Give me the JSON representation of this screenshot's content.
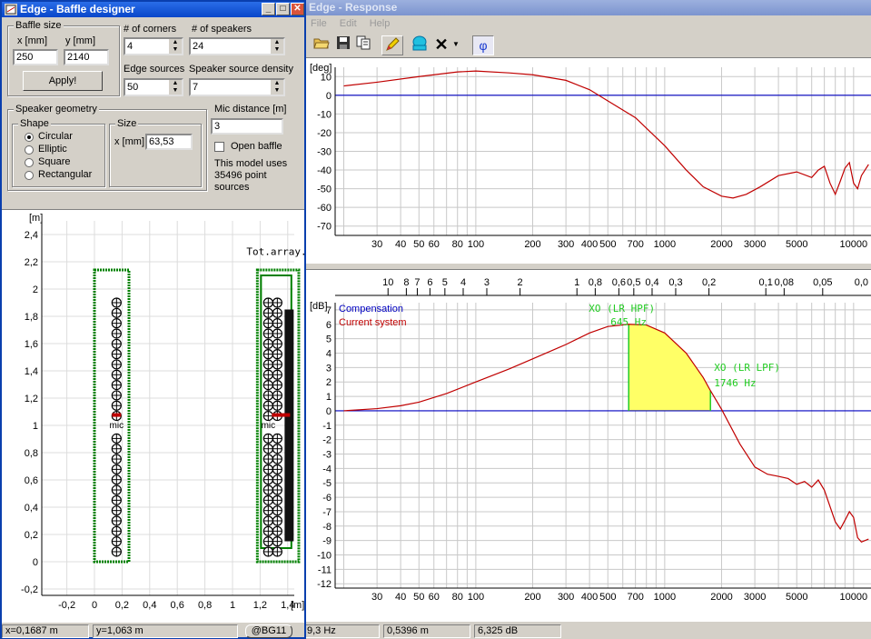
{
  "baffle_designer": {
    "title": "Edge - Baffle designer",
    "baffle_size": {
      "legend": "Baffle size",
      "x_label": "x [mm]",
      "y_label": "y [mm]",
      "x_value": "250",
      "y_value": "2140",
      "apply_label": "Apply!"
    },
    "corners_label": "# of corners",
    "corners_value": "4",
    "speakers_label": "# of speakers",
    "speakers_value": "24",
    "edge_sources_label": "Edge sources",
    "edge_sources_value": "50",
    "density_label": "Speaker source density",
    "density_value": "7",
    "speaker_geometry": {
      "legend": "Speaker geometry",
      "shape_legend": "Shape",
      "shapes": [
        "Circular",
        "Elliptic",
        "Square",
        "Rectangular"
      ],
      "selected_shape": "Circular",
      "size_legend": "Size",
      "size_label": "x [mm]",
      "size_value": "63,53"
    },
    "mic_distance_label": "Mic distance [m]",
    "mic_distance_value": "3",
    "open_baffle_label": "Open baffle",
    "model_info": "This model uses 35496 point sources",
    "plot": {
      "y_unit": "[m]",
      "x_unit": "[m]",
      "y_ticks": [
        "2,4",
        "2,2",
        "2",
        "1,8",
        "1,6",
        "1,4",
        "1,2",
        "1",
        "0,8",
        "0,6",
        "0,4",
        "0,2",
        "0",
        "-0,2"
      ],
      "x_ticks": [
        "-0,2",
        "0",
        "0,2",
        "0,4",
        "0,6",
        "0,8",
        "1",
        "1,2",
        "1,4"
      ],
      "mic_label": "mic",
      "mic2_label": "mic",
      "tot_array_label": "Tot.array."
    },
    "status": {
      "x": "x=0,1687 m",
      "y": "y=1,063 m",
      "badge": "@BG11"
    }
  },
  "response": {
    "title": "Edge - Response",
    "menu": [
      "File",
      "Edit",
      "Help"
    ],
    "toolbar_icons": [
      "open-folder-icon",
      "save-icon",
      "copy-icon",
      "pencil-icon",
      "speaker-icon",
      "delete-x-icon",
      "dropdown-arrow-icon",
      "phi-icon"
    ],
    "phase_phi_glyph": "φ",
    "phase_plot": {
      "unit": "[deg]",
      "y_ticks": [
        "10",
        "0",
        "-10",
        "-20",
        "-30",
        "-40",
        "-50",
        "-60",
        "-70"
      ],
      "x_ticks": [
        "30",
        "40",
        "50",
        "60",
        "80",
        "100",
        "200",
        "300",
        "400",
        "500",
        "700",
        "1000",
        "2000",
        "3000",
        "5000",
        "10000"
      ]
    },
    "wavelength_ticks": [
      "10",
      "8",
      "7",
      "6",
      "5",
      "4",
      "3",
      "2",
      "1",
      "0,8",
      "0,6",
      "0,5",
      "0,4",
      "0,3",
      "0,2",
      "0,1",
      "0,08",
      "0,05",
      "0,0"
    ],
    "mag_plot": {
      "unit": "[dB]",
      "y_ticks": [
        "7",
        "6",
        "5",
        "4",
        "3",
        "2",
        "1",
        "0",
        "-1",
        "-2",
        "-3",
        "-4",
        "-5",
        "-6",
        "-7",
        "-8",
        "-9",
        "-10",
        "-11",
        "-12"
      ],
      "x_ticks": [
        "30",
        "40",
        "50",
        "60",
        "80",
        "100",
        "200",
        "300",
        "400",
        "500",
        "700",
        "1000",
        "2000",
        "3000",
        "5000",
        "10000"
      ],
      "legend": [
        "Compensation",
        "Current system"
      ],
      "xo_hpf_label": "XO (LR HPF)",
      "xo_hpf_freq": "645 Hz",
      "xo_lpf_label": "XO (LR LPF)",
      "xo_lpf_freq": "1746 Hz"
    },
    "status": {
      "freq": "9,3 Hz",
      "dist": "0,5396 m",
      "level": "6,325 dB"
    },
    "colors": {
      "compensation": "#0000c0",
      "current_system": "#c00000",
      "xo_marker": "#22cc22",
      "xo_fill": "#ffff66"
    }
  }
}
